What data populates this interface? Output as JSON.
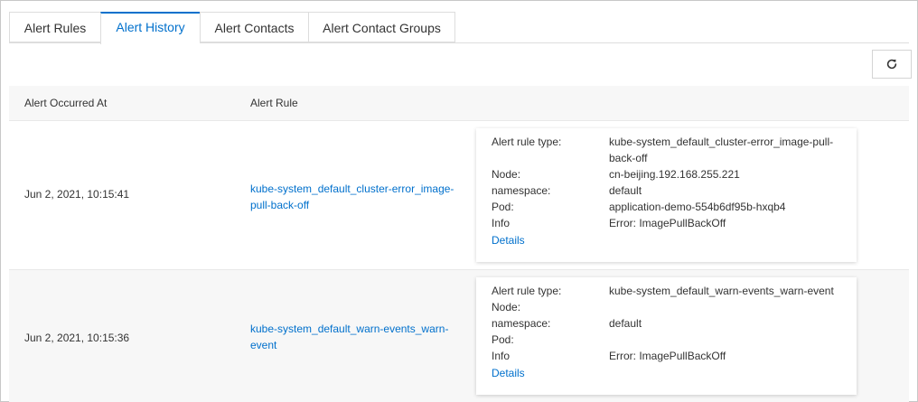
{
  "tabs": [
    {
      "label": "Alert Rules"
    },
    {
      "label": "Alert History"
    },
    {
      "label": "Alert Contacts"
    },
    {
      "label": "Alert Contact Groups"
    }
  ],
  "active_tab": "Alert History",
  "toolbar": {
    "refresh_icon": "refresh-icon"
  },
  "table": {
    "columns": [
      "Alert Occurred At",
      "Alert Rule"
    ],
    "rows": [
      {
        "time": "Jun 2, 2021, 10:15:41",
        "rule": "kube-system_default_cluster-error_image-pull-back-off",
        "details": {
          "rule_type_label": "Alert rule type:",
          "rule_type_value": "kube-system_default_cluster-error_image-pull-back-off",
          "node_label": "Node:",
          "node_value": "cn-beijing.192.168.255.221",
          "namespace_label": "namespace:",
          "namespace_value": "default",
          "pod_label": "Pod:",
          "pod_value": "application-demo-554b6df95b-hxqb4",
          "info_label": "Info",
          "info_value": "Error: ImagePullBackOff",
          "link": "Details"
        }
      },
      {
        "time": "Jun 2, 2021, 10:15:36",
        "rule": "kube-system_default_warn-events_warn-event",
        "details": {
          "rule_type_label": "Alert rule type:",
          "rule_type_value": "kube-system_default_warn-events_warn-event",
          "node_label": "Node:",
          "node_value": "",
          "namespace_label": "namespace:",
          "namespace_value": "default",
          "pod_label": "Pod:",
          "pod_value": "",
          "info_label": "Info",
          "info_value": "Error: ImagePullBackOff",
          "link": "Details"
        }
      }
    ]
  },
  "colors": {
    "accent": "#0070cc",
    "header_bg": "#f7f7f7",
    "border": "#dddddd"
  }
}
